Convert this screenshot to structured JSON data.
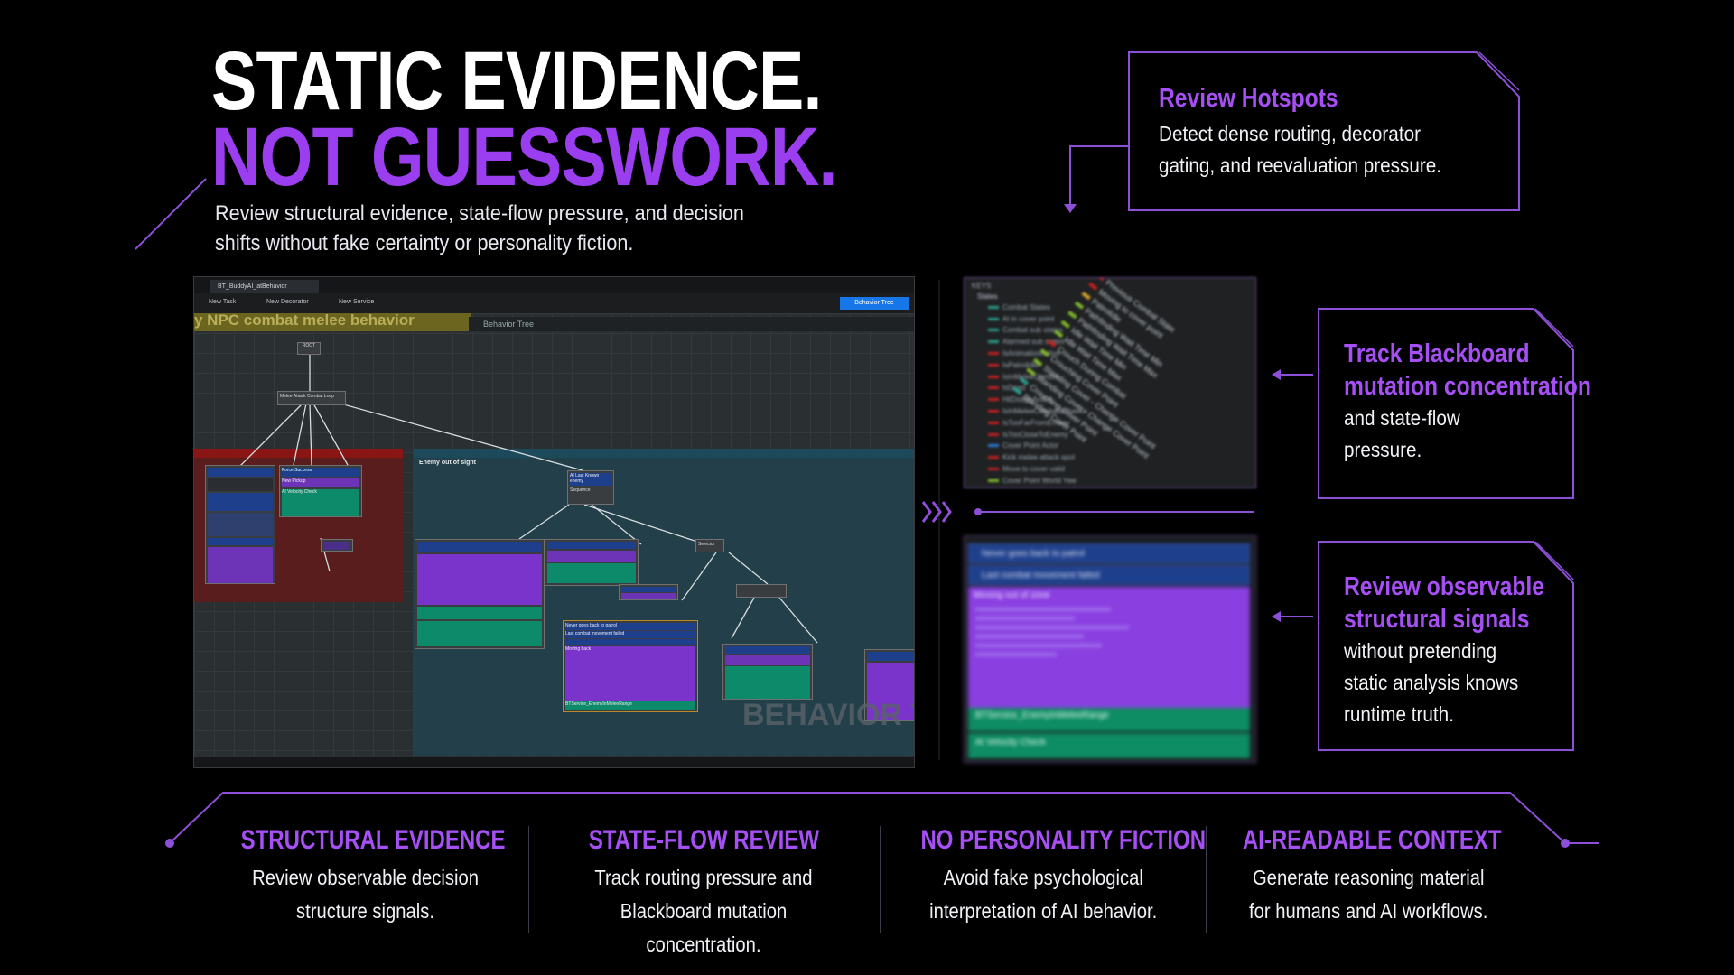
{
  "hero": {
    "line1": "STATIC EVIDENCE.",
    "line2": "NOT GUESSWORK.",
    "subtitle": "Review structural evidence, state-flow pressure, and decision shifts without fake certainty or personality fiction."
  },
  "callouts": {
    "hotspots": {
      "title": "Review Hotspots",
      "text": "Detect dense routing, decorator gating, and reevaluation pressure."
    },
    "blackboard": {
      "title_l1": "Track Blackboard",
      "title_l2": "mutation concentration",
      "text": "and state-flow pressure."
    },
    "signals": {
      "title_l1": "Review observable",
      "title_l2": "structural signals",
      "text": "without pretending static analysis knows runtime truth."
    }
  },
  "editor": {
    "tab": "BT_BuddyAI_atBehavior",
    "toolbar": [
      "New Task",
      "New Decorator",
      "New Service"
    ],
    "behavior_tree_button": "Behavior Tree",
    "comment_label": "y NPC combat melee behavior",
    "graph_label": "Behavior Tree",
    "teal_comment": "Enemy out of sight",
    "watermark": "BEHAVIOR TR",
    "nodes": {
      "root": "ROOT",
      "melee": "Melee Attack Combat Loop",
      "force_success": "Force Success",
      "new_pickup": "New Pickup",
      "velocity_check": "AI Velocity Check",
      "last_enemy": "AI Last Known enemy",
      "sequence": "Sequence",
      "selector": "Selector",
      "never_back": "Never goes back to patrol",
      "last_combat": "Last combat movement failed",
      "moving_back": "Moving back",
      "service": "BTService_EnemyInMeleeRange"
    }
  },
  "keys_panel": {
    "header": "KEYS",
    "group": "States",
    "keys": [
      {
        "name": "Combat States",
        "color": "#2d9b8a"
      },
      {
        "name": "AI in cover point",
        "color": "#2d9b8a"
      },
      {
        "name": "Combat sub states",
        "color": "#2d9b8a"
      },
      {
        "name": "Alarmed sub states",
        "color": "#2d9b8a"
      },
      {
        "name": "IsAnimationActive",
        "color": "#c42020"
      },
      {
        "name": "IsPatrolIdle",
        "color": "#c42020"
      },
      {
        "name": "IsInMeleeCombat",
        "color": "#c42020"
      },
      {
        "name": "IsDead",
        "color": "#c42020"
      },
      {
        "name": "HitDodgeAction",
        "color": "#c42020"
      },
      {
        "name": "IsInMeleeCombatBehavior",
        "color": "#c42020"
      },
      {
        "name": "IsTooFarFromEnemy",
        "color": "#c42020"
      },
      {
        "name": "IsTooCloseToEnemy",
        "color": "#c42020"
      },
      {
        "name": "Cover Point Actor",
        "color": "#2a7bd4"
      },
      {
        "name": "Kick melee attack spot",
        "color": "#c42020"
      },
      {
        "name": "Move to cover valid",
        "color": "#c42020"
      },
      {
        "name": "Cover Point World Yaw",
        "color": "#7fb82a"
      }
    ],
    "diagonal": [
      {
        "name": "Previous Combat State",
        "color": "#c42020"
      },
      {
        "name": "Moving to cover point",
        "color": "#c42020"
      },
      {
        "name": "PatrolIdle",
        "color": "#d4a22a"
      },
      {
        "name": "Pathfinding Wait Time Min",
        "color": "#7fb82a"
      },
      {
        "name": "Pathfinding Wait Time Max",
        "color": "#7fb82a"
      },
      {
        "name": "Idle Wait Time Min",
        "color": "#7fb82a"
      },
      {
        "name": "Idle Wait Time Max",
        "color": "#7fb82a"
      },
      {
        "name": "Crouch During Combat",
        "color": "#c42020"
      },
      {
        "name": "Crouching Cover Point",
        "color": "#7fb82a"
      },
      {
        "name": "Standing Cover - Change Cover Point",
        "color": "#7fb82a"
      },
      {
        "name": "Standing Cover - Change Cover Point",
        "color": "#7fb82a"
      },
      {
        "name": "Crouching Cover Point",
        "color": "#2d9b8a"
      },
      {
        "name": "Standing Cover Point",
        "color": "#2d9b8a"
      }
    ]
  },
  "node_panel": {
    "blue_rows": [
      "Never goes back to patrol",
      "Last combat movement failed"
    ],
    "purple_title": "Moving out of zone",
    "green_rows": [
      "BTService_EnemyInMeleeRange",
      "AI Velocity Check"
    ]
  },
  "features": [
    {
      "title": "STRUCTURAL EVIDENCE",
      "line1": "Review observable decision",
      "line2": "structure signals."
    },
    {
      "title": "STATE-FLOW REVIEW",
      "line1": "Track routing pressure and",
      "line2": "Blackboard mutation concentration."
    },
    {
      "title": "NO PERSONALITY FICTION",
      "line1": "Avoid fake psychological",
      "line2": "interpretation of AI behavior."
    },
    {
      "title": "AI-READABLE CONTEXT",
      "line1": "Generate reasoning material",
      "line2": "for humans and AI workflows."
    }
  ],
  "colors": {
    "accent": "#a64ff5",
    "hero_purple": "#9a3ef0",
    "frame": "#8e4fd8",
    "background": "#000000"
  }
}
